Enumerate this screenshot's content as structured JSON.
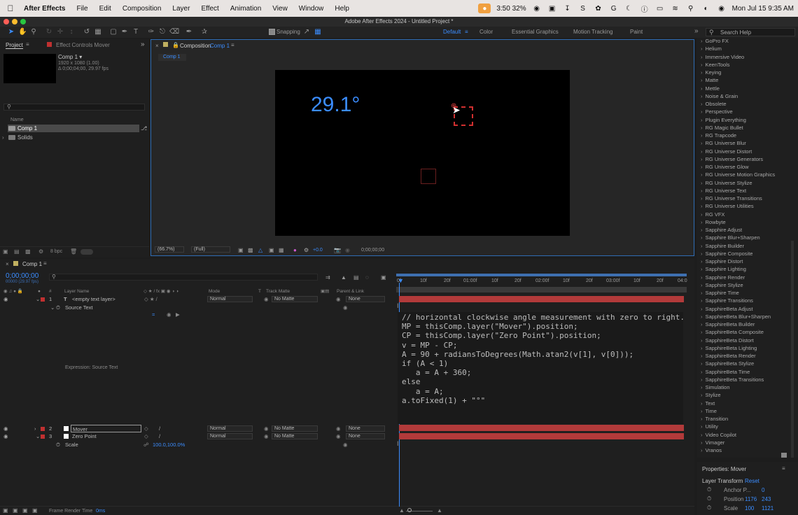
{
  "menubar": {
    "app_name": "After Effects",
    "items": [
      "File",
      "Edit",
      "Composition",
      "Layer",
      "Effect",
      "Animation",
      "View",
      "Window",
      "Help"
    ],
    "status": "3:50 32%",
    "clock": "Mon Jul 15  9:35 AM"
  },
  "window": {
    "title": "Adobe After Effects 2024 - Untitled Project *"
  },
  "toolbar": {
    "snapping_label": "Snapping",
    "workspaces": [
      "Default",
      "Color",
      "Essential Graphics",
      "Motion Tracking",
      "Paint"
    ],
    "search_help": "Search Help"
  },
  "project": {
    "tab_project": "Project",
    "tab_effect_controls": "Effect Controls Mover",
    "comp_name": "Comp 1 ▾",
    "comp_info_1": "1920 x 1080 (1.00)",
    "comp_info_2": "Δ 0;00;04;00, 29.97 fps",
    "col_name": "Name",
    "items": [
      "Comp 1",
      "Solids"
    ],
    "bpc": "8 bpc"
  },
  "comp": {
    "tab_prefix": "Composition",
    "tab_name": "Comp 1",
    "breadcrumb": "Comp 1",
    "angle_text": "29.1°",
    "zoom": "(66.7%)",
    "resolution": "(Full)",
    "exposure": "+0.0",
    "timecode": "0;00;00;00"
  },
  "effects": {
    "items": [
      "GoPro FX",
      "Helium",
      "Immersive Video",
      "KeenTools",
      "Keying",
      "Matte",
      "Mettle",
      "Noise & Grain",
      "Obsolete",
      "Perspective",
      "Plugin Everything",
      "RG Magic Bullet",
      "RG Trapcode",
      "RG Universe Blur",
      "RG Universe Distort",
      "RG Universe Generators",
      "RG Universe Glow",
      "RG Universe Motion Graphics",
      "RG Universe Stylize",
      "RG Universe Text",
      "RG Universe Transitions",
      "RG Universe Utilities",
      "RG VFX",
      "Rowbyte",
      "Sapphire Adjust",
      "Sapphire Blur+Sharpen",
      "Sapphire Builder",
      "Sapphire Composite",
      "Sapphire Distort",
      "Sapphire Lighting",
      "Sapphire Render",
      "Sapphire Stylize",
      "Sapphire Time",
      "Sapphire Transitions",
      "SapphireBeta Adjust",
      "SapphireBeta Blur+Sharpen",
      "SapphireBeta Builder",
      "SapphireBeta Composite",
      "SapphireBeta Distort",
      "SapphireBeta Lighting",
      "SapphireBeta Render",
      "SapphireBeta Stylize",
      "SapphireBeta Time",
      "SapphireBeta Transitions",
      "Simulation",
      "Stylize",
      "Text",
      "Time",
      "Transition",
      "Utility",
      "Video Copilot",
      "Vimager",
      "Vranos"
    ]
  },
  "properties": {
    "title": "Properties: Mover",
    "section": "Layer Transform",
    "reset": "Reset",
    "anchor_label": "Anchor P...",
    "anchor_value": "0",
    "position_label": "Position",
    "position_x": "1176",
    "position_y": "243",
    "scale_label": "Scale",
    "scale_x": "100",
    "scale_y": "1121"
  },
  "timeline": {
    "tab": "Comp 1",
    "timecode": "0;00;00;00",
    "timecode_sub": "00000 (29.97 fps)",
    "col_layer_name": "Layer Name",
    "col_mode": "Mode",
    "col_t": "T",
    "col_track_matte": "Track Matte",
    "col_parent": "Parent & Link",
    "ruler": [
      "0f",
      "10f",
      "20f",
      "01:00f",
      "10f",
      "20f",
      "02:00f",
      "10f",
      "20f",
      "03:00f",
      "10f",
      "20f",
      "04:0"
    ],
    "layers": [
      {
        "num": "1",
        "name": "<empty text layer>",
        "mode": "Normal",
        "matte": "No Matte",
        "parent": "None"
      },
      {
        "num": "2",
        "name": "Mover",
        "mode": "Normal",
        "matte": "No Matte",
        "parent": "None"
      },
      {
        "num": "3",
        "name": "Zero Point",
        "mode": "Normal",
        "matte": "No Matte",
        "parent": "None"
      }
    ],
    "source_text": "Source Text",
    "expression_label": "Expression: Source Text",
    "scale_label": "Scale",
    "scale_value": "100.0,100.0%",
    "frame_render_label": "Frame Render Time",
    "frame_render_value": "0ms"
  },
  "expression": {
    "lines": [
      "// horizontal clockwise angle measurement with zero to right.",
      "MP = thisComp.layer(\"Mover\").position;",
      "CP = thisComp.layer(\"Zero Point\").position;",
      "v = MP - CP;",
      "A = 90 + radiansToDegrees(Math.atan2(v[1], v[0]));",
      "if (A < 1)",
      "   a = A + 360;",
      "else",
      "   a = A;",
      "a.toFixed(1) + \"°\""
    ]
  },
  "colors": {
    "accent_blue": "#3b8dff",
    "layer_red": "#b23a3a",
    "panel_bg": "#1f1f1f"
  }
}
